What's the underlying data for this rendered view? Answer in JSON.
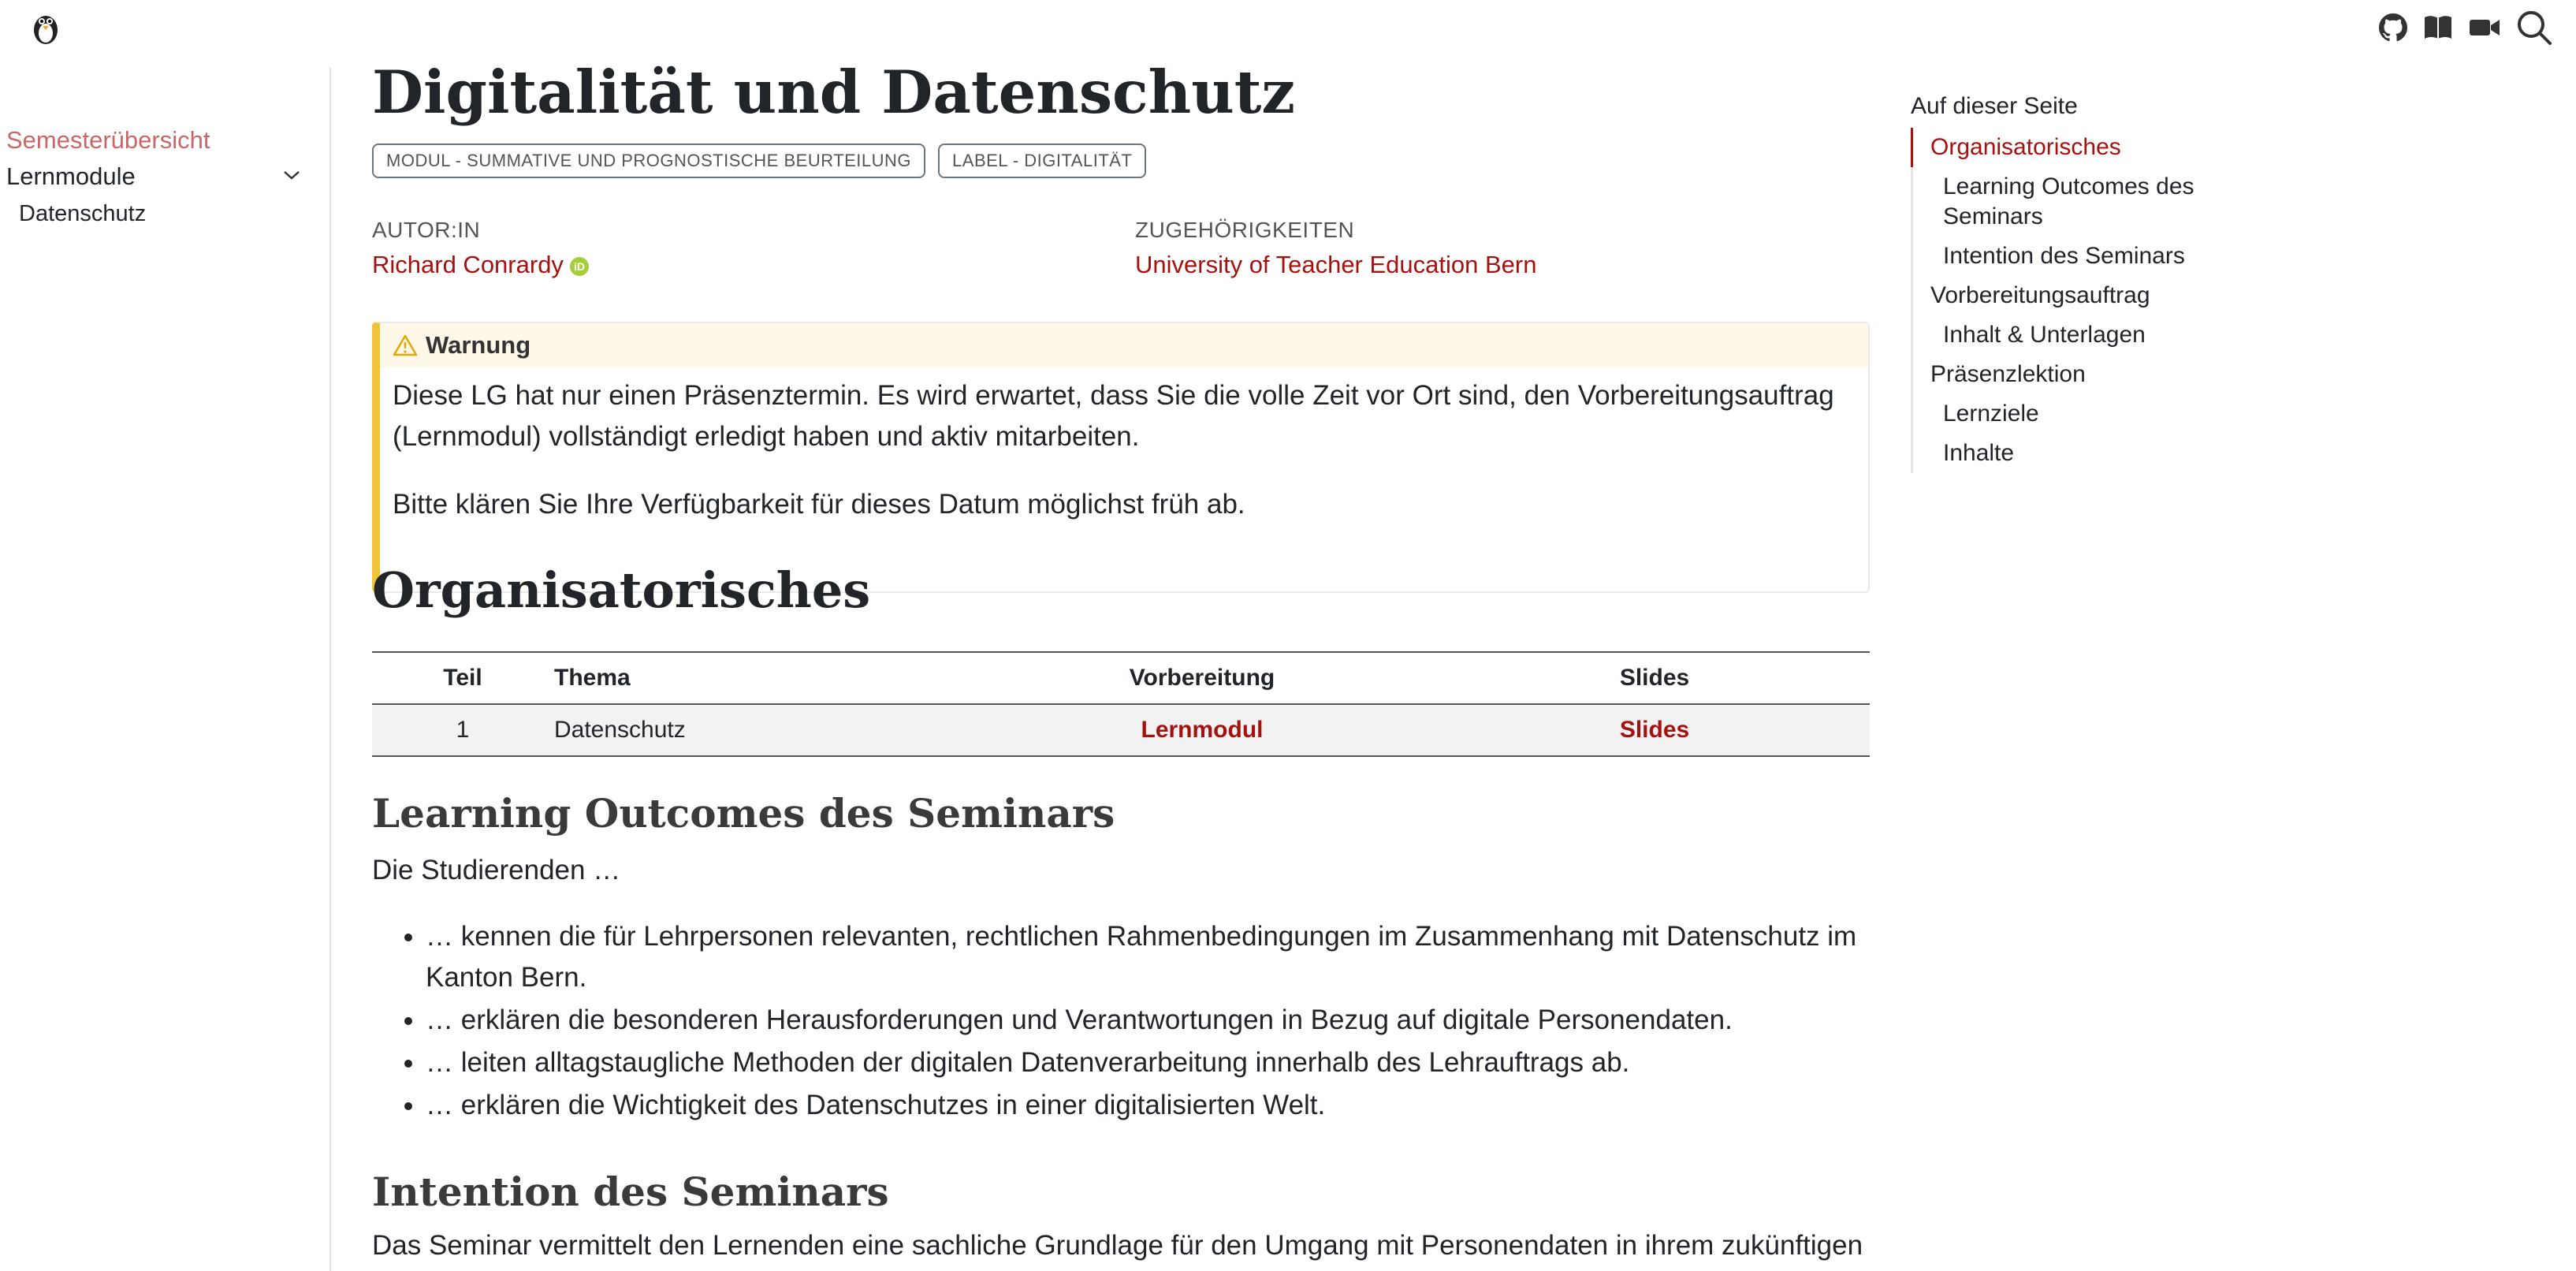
{
  "header": {
    "logo": "penguin-logo",
    "icons": [
      "github-icon",
      "book-icon",
      "video-icon",
      "search-icon"
    ]
  },
  "sidebar": {
    "items": [
      {
        "label": "Semesterübersicht"
      },
      {
        "label": "Lernmodule"
      },
      {
        "label": "Datenschutz"
      }
    ]
  },
  "main": {
    "title": "Digitalität und Datenschutz",
    "badges": [
      "MODUL - SUMMATIVE UND PROGNOSTISCHE BEURTEILUNG",
      "LABEL - DIGITALITÄT"
    ],
    "author_heading": "AUTOR:IN",
    "author": "Richard Conrardy",
    "affiliation_heading": "ZUGEHÖRIGKEITEN",
    "affiliation": "University of Teacher Education Bern",
    "callout": {
      "title": "Warnung",
      "p1": "Diese LG hat nur einen Präsenztermin. Es wird erwartet, dass Sie die volle Zeit vor Ort sind, den Vorbereitungsauftrag (Lernmodul) vollständigt erledigt haben und aktiv mitarbeiten.",
      "p2": "Bitte klären Sie Ihre Verfügbarkeit für dieses Datum möglichst früh ab."
    },
    "org_heading": "Organisatorisches",
    "table": {
      "headers": [
        "Teil",
        "Thema",
        "Vorbereitung",
        "Slides"
      ],
      "row": [
        "1",
        "Datenschutz",
        "Lernmodul",
        "Slides"
      ]
    },
    "lo_heading": "Learning Outcomes des Seminars",
    "lo_lead": "Die Studierenden …",
    "outcomes": [
      "… kennen die für Lehrpersonen relevanten, rechtlichen Rahmenbedingungen im Zusammenhang mit Datenschutz im Kanton Bern.",
      "… erklären die besonderen Herausforderungen und Verantwortungen in Bezug auf digitale Personendaten.",
      "… leiten alltagstaugliche Methoden der digitalen Datenverarbeitung innerhalb des Lehrauftrags ab.",
      "… erklären die Wichtigkeit des Datenschutzes in einer digitalisierten Welt."
    ],
    "intention_heading": "Intention des Seminars",
    "intention_text": "Das Seminar vermittelt den Lernenden eine sachliche Grundlage für den Umgang mit Personendaten in ihrem zukünftigen"
  },
  "toc": {
    "title": "Auf dieser Seite",
    "items": [
      "Organisatorisches",
      "Learning Outcomes des Seminars",
      "Intention des Seminars",
      "Vorbereitungsauftrag",
      "Inhalt & Unterlagen",
      "Präsenzlektion",
      "Lernziele",
      "Inhalte"
    ]
  },
  "colors": {
    "accent": "#a3120f",
    "callout_border": "#f0c43a"
  }
}
